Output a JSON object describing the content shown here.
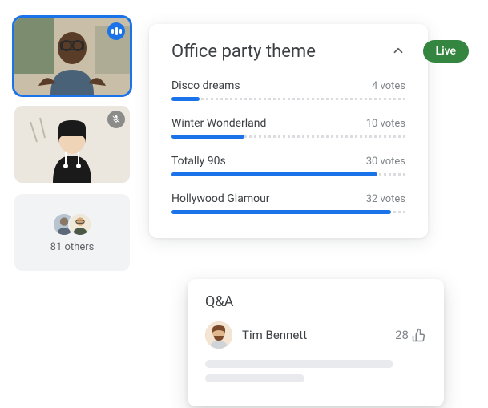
{
  "live_badge": "Live",
  "participants": {
    "others_count": "81 others"
  },
  "poll": {
    "title": "Office party theme",
    "options": [
      {
        "label": "Disco dreams",
        "votes": "4 votes",
        "percent": 12
      },
      {
        "label": "Winter Wonderland",
        "votes": "10 votes",
        "percent": 31
      },
      {
        "label": "Totally 90s",
        "votes": "30 votes",
        "percent": 88
      },
      {
        "label": "Hollywood Glamour",
        "votes": "32 votes",
        "percent": 94
      }
    ]
  },
  "qa": {
    "title": "Q&A",
    "entry": {
      "author": "Tim Bennett",
      "upvotes": "28"
    }
  }
}
